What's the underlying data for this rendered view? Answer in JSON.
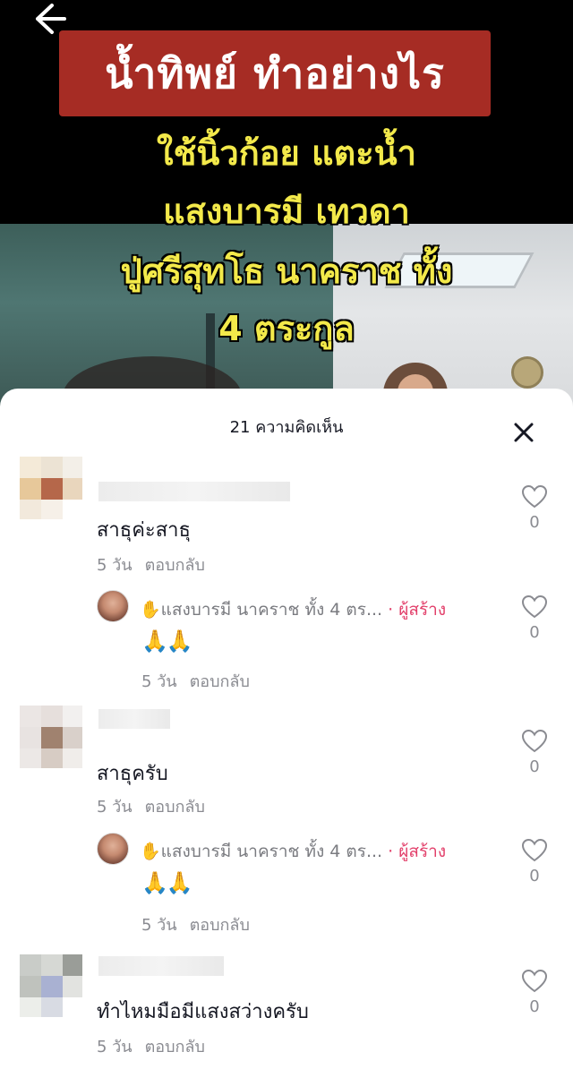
{
  "video": {
    "banner": "น้ำทิพย์ ทำอย่างไร",
    "captions": [
      "ใช้นิ้วก้อย แตะน้ำ",
      "แสงบารมี เทวดา",
      "ปู่ศรีสุทโธ นาคราช ทั้ง",
      "4 ตระกูล"
    ]
  },
  "sheet": {
    "title": "21 ความคิดเห็น"
  },
  "comments": [
    {
      "text": "สาธุค่ะสาธุ",
      "time": "5 วัน",
      "reply_label": "ตอบกลับ",
      "likes": "0",
      "reply": {
        "author": "แสงบารมี นาคราช ทั้ง 4 ตร...",
        "creator_label": "· ผู้สร้าง",
        "text": "🙏🙏",
        "time": "5 วัน",
        "reply_label": "ตอบกลับ",
        "likes": "0"
      }
    },
    {
      "text": "สาธุครับ",
      "time": "5 วัน",
      "reply_label": "ตอบกลับ",
      "likes": "0",
      "reply": {
        "author": "แสงบารมี นาคราช ทั้ง 4 ตร...",
        "creator_label": "· ผู้สร้าง",
        "text": "🙏🙏",
        "time": "5 วัน",
        "reply_label": "ตอบกลับ",
        "likes": "0"
      }
    },
    {
      "text": "ทำไหมมือมีแสงสว่างครับ",
      "time": "5 วัน",
      "reply_label": "ตอบกลับ",
      "likes": "0"
    }
  ]
}
